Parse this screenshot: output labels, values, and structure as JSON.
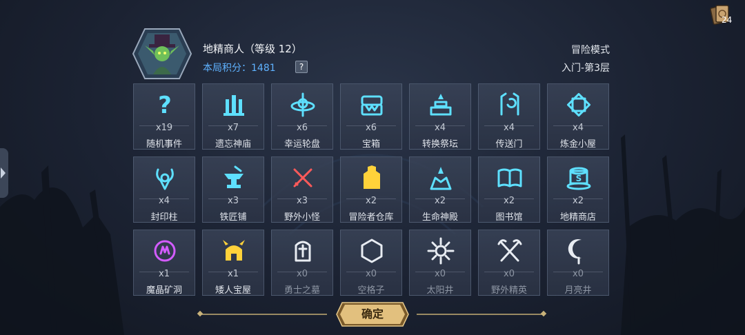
{
  "header": {
    "hero_name": "地精商人（等级 12）",
    "score_label": "本局积分：",
    "score_value": "1481",
    "help": "?",
    "mode": "冒险模式",
    "floor": "入门-第3层"
  },
  "deck": {
    "count": "24",
    "icon": "card-deck-icon"
  },
  "tiles": [
    {
      "count": "x19",
      "label": "随机事件",
      "icon": "question-icon",
      "color": "#5ee0ff"
    },
    {
      "count": "x7",
      "label": "遗忘神庙",
      "icon": "temple-icon",
      "color": "#5ee0ff"
    },
    {
      "count": "x6",
      "label": "幸运轮盘",
      "icon": "wheel-icon",
      "color": "#5ee0ff"
    },
    {
      "count": "x6",
      "label": "宝箱",
      "icon": "chest-icon",
      "color": "#5ee0ff"
    },
    {
      "count": "x4",
      "label": "转换祭坛",
      "icon": "altar-icon",
      "color": "#5ee0ff"
    },
    {
      "count": "x4",
      "label": "传送门",
      "icon": "portal-icon",
      "color": "#5ee0ff"
    },
    {
      "count": "x4",
      "label": "炼金小屋",
      "icon": "alchemy-icon",
      "color": "#5ee0ff"
    },
    {
      "count": "x4",
      "label": "封印柱",
      "icon": "seal-icon",
      "color": "#5ee0ff"
    },
    {
      "count": "x3",
      "label": "铁匠铺",
      "icon": "anvil-icon",
      "color": "#5ee0ff"
    },
    {
      "count": "x3",
      "label": "野外小怪",
      "icon": "crossed-swords-icon",
      "color": "#ff5a5a"
    },
    {
      "count": "x2",
      "label": "冒险者仓库",
      "icon": "warehouse-icon",
      "color": "#ffd23a"
    },
    {
      "count": "x2",
      "label": "生命神殿",
      "icon": "shrine-icon",
      "color": "#5ee0ff"
    },
    {
      "count": "x2",
      "label": "图书馆",
      "icon": "book-icon",
      "color": "#5ee0ff"
    },
    {
      "count": "x2",
      "label": "地精商店",
      "icon": "shop-icon",
      "color": "#5ee0ff"
    },
    {
      "count": "x1",
      "label": "魔晶矿洞",
      "icon": "crystal-mine-icon",
      "color": "#d35cff"
    },
    {
      "count": "x1",
      "label": "矮人宝屋",
      "icon": "dwarf-helmet-icon",
      "color": "#ffd23a"
    },
    {
      "count": "x0",
      "label": "勇士之墓",
      "icon": "tombstone-icon",
      "color": "#e8ecf2"
    },
    {
      "count": "x0",
      "label": "空格子",
      "icon": "hexagon-icon",
      "color": "#e8ecf2"
    },
    {
      "count": "x0",
      "label": "太阳井",
      "icon": "sun-icon",
      "color": "#e8ecf2"
    },
    {
      "count": "x0",
      "label": "野外精英",
      "icon": "crossed-axes-icon",
      "color": "#e8ecf2"
    },
    {
      "count": "x0",
      "label": "月亮井",
      "icon": "moon-icon",
      "color": "#e8ecf2"
    }
  ],
  "footer": {
    "confirm_label": "确定"
  }
}
